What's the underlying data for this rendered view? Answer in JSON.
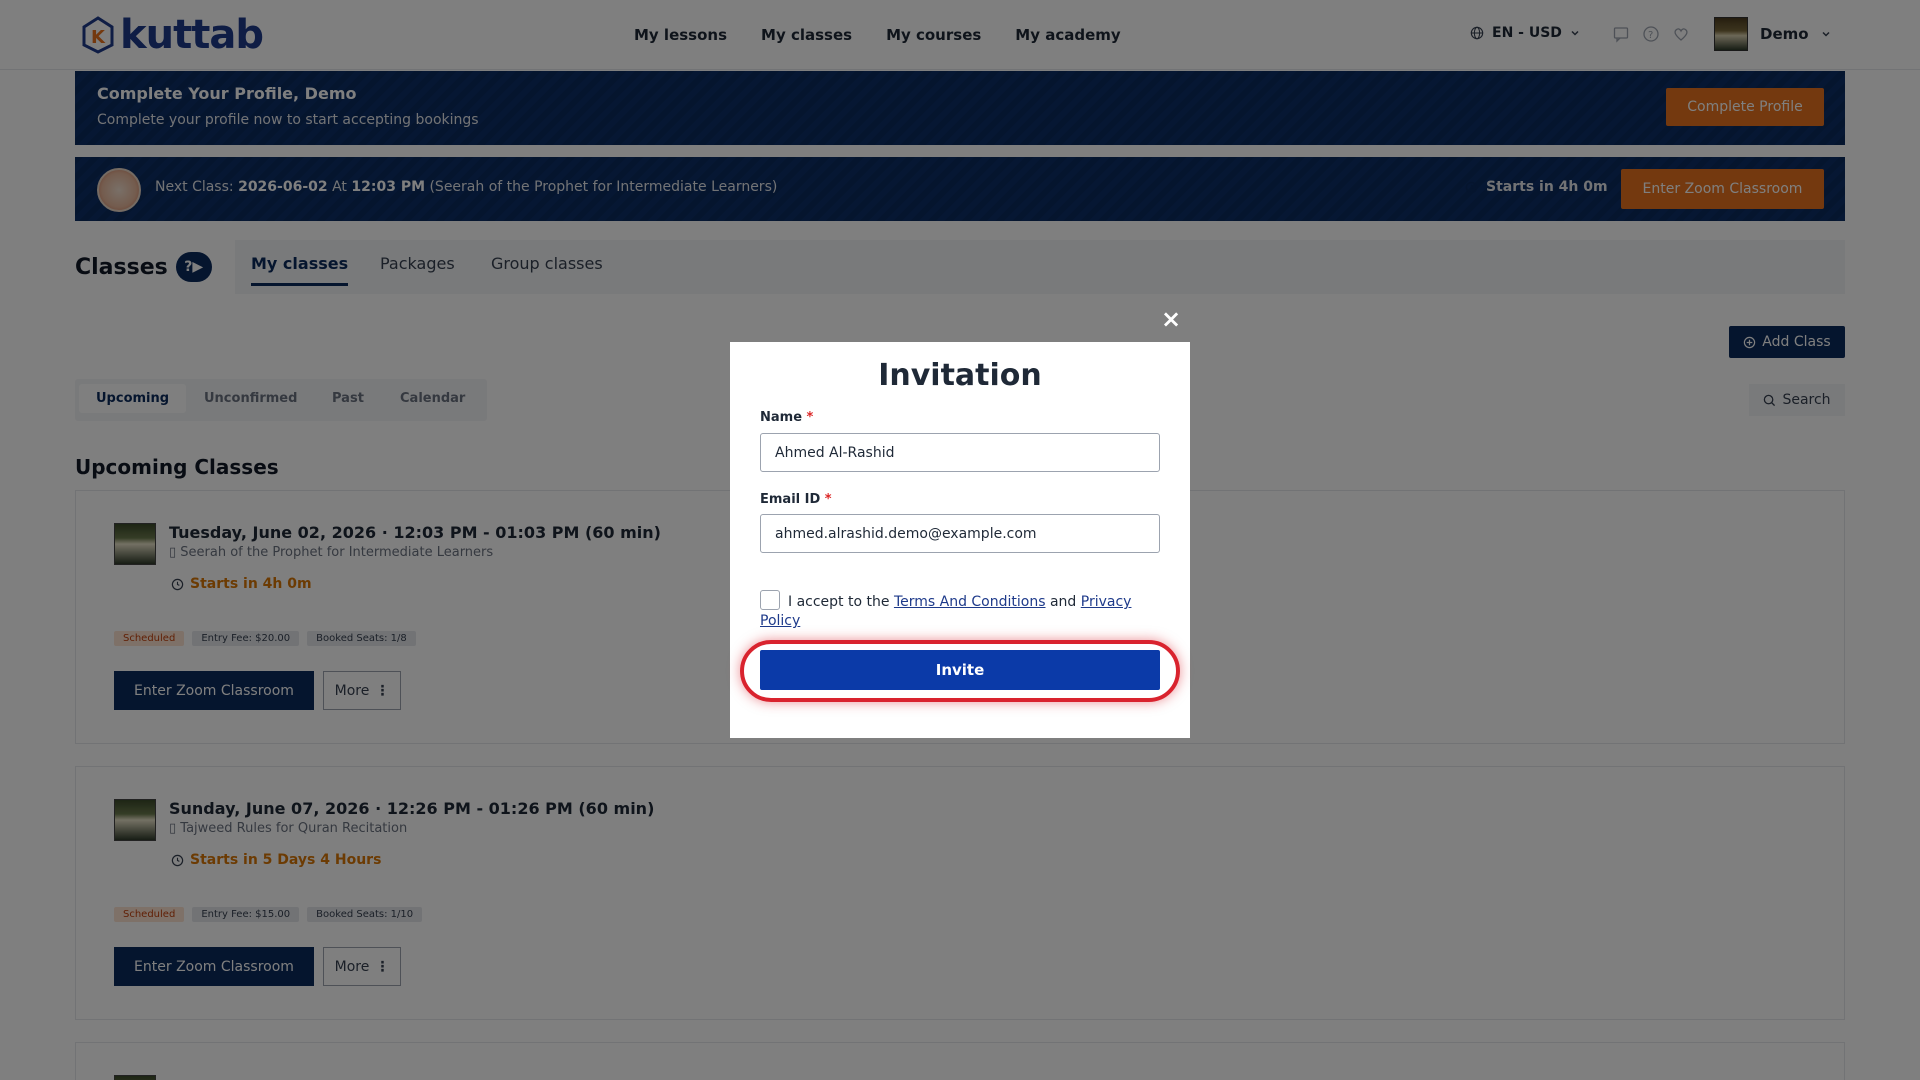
{
  "brand": {
    "name": "kuttab"
  },
  "nav": {
    "items": [
      "My lessons",
      "My classes",
      "My courses",
      "My academy"
    ]
  },
  "header": {
    "lang": "EN - USD",
    "user": "Demo"
  },
  "banner_profile": {
    "title": "Complete Your Profile, Demo",
    "subtitle": "Complete your profile now to start accepting bookings",
    "button": "Complete Profile"
  },
  "banner_next": {
    "prefix": "Next Class:",
    "date": "2026-06-02",
    "at": "At",
    "time": "12:03 PM",
    "course": "(Seerah of the Prophet for Intermediate Learners)",
    "starts": "Starts in 4h 0m",
    "button": "Enter Zoom Classroom"
  },
  "classes": {
    "title": "Classes",
    "help": "?▶",
    "tabs": [
      "My classes",
      "Packages",
      "Group classes"
    ],
    "add_button": "Add Class"
  },
  "subtabs": [
    "Upcoming",
    "Unconfirmed",
    "Past",
    "Calendar"
  ],
  "search": {
    "label": "Search"
  },
  "section": {
    "title": "Upcoming Classes"
  },
  "cards": [
    {
      "date": "Tuesday, June 02, 2026 · 12:03 PM - 01:03 PM (60 min)",
      "course": "Seerah of the Prophet for Intermediate Learners",
      "starts": "Starts in 4h 0m",
      "status": "Scheduled",
      "fee": "Entry Fee: $20.00",
      "seats": "Booked Seats: 1/8",
      "enter": "Enter Zoom Classroom",
      "more": "More"
    },
    {
      "date": "Sunday, June 07, 2026 · 12:26 PM - 01:26 PM (60 min)",
      "course": "Tajweed Rules for Quran Recitation",
      "starts": "Starts in 5 Days 4 Hours",
      "status": "Scheduled",
      "fee": "Entry Fee: $15.00",
      "seats": "Booked Seats: 1/10",
      "enter": "Enter Zoom Classroom",
      "more": "More"
    }
  ],
  "modal": {
    "title": "Invitation",
    "name_label": "Name",
    "name_value": "Ahmed Al-Rashid",
    "email_label": "Email ID",
    "email_value": "ahmed.alrashid.demo@example.com",
    "terms_prefix": "I accept to the",
    "terms_link": "Terms And Conditions",
    "terms_and": "and",
    "privacy_link": "Privacy Policy",
    "invite_button": "Invite",
    "close": "×"
  },
  "colors": {
    "primary": "#0b2a5c",
    "accent": "#e8731e",
    "invite": "#0b3aa8",
    "highlight": "#d9232e"
  }
}
